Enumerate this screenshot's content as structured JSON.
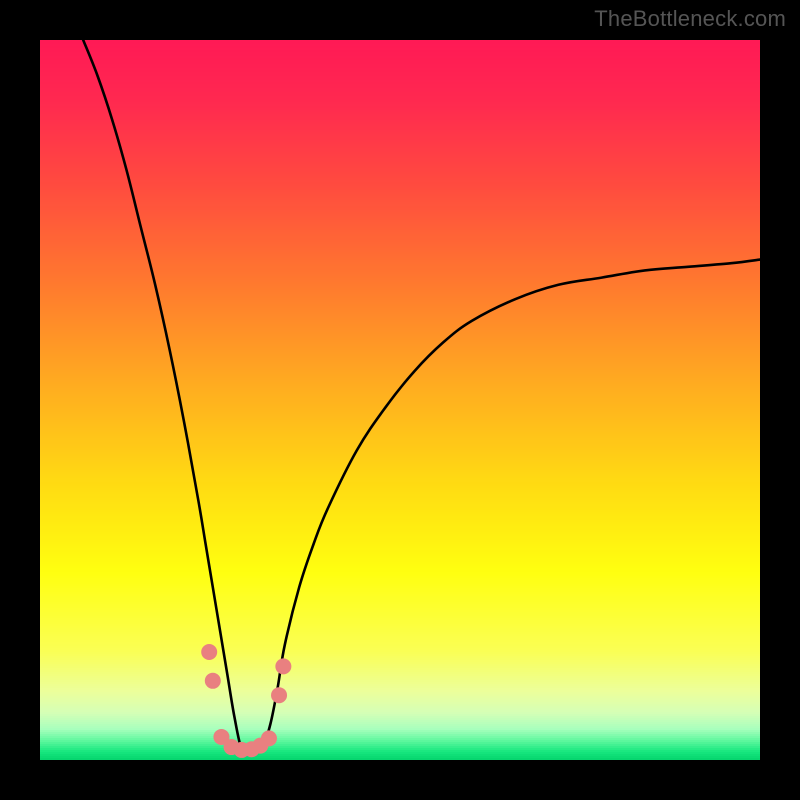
{
  "watermark": "TheBottleneck.com",
  "colors": {
    "frame": "#000000",
    "curve_stroke": "#000000",
    "marker_fill": "#e98080",
    "gradient_stops": [
      {
        "pos": 0.0,
        "color": "#ff1a55"
      },
      {
        "pos": 0.08,
        "color": "#ff2850"
      },
      {
        "pos": 0.2,
        "color": "#ff4b3f"
      },
      {
        "pos": 0.34,
        "color": "#ff7a2e"
      },
      {
        "pos": 0.5,
        "color": "#ffb31e"
      },
      {
        "pos": 0.62,
        "color": "#ffdc12"
      },
      {
        "pos": 0.74,
        "color": "#ffff10"
      },
      {
        "pos": 0.85,
        "color": "#faff55"
      },
      {
        "pos": 0.905,
        "color": "#ecff9a"
      },
      {
        "pos": 0.935,
        "color": "#d6ffb6"
      },
      {
        "pos": 0.958,
        "color": "#a9ffbd"
      },
      {
        "pos": 0.975,
        "color": "#5cf79d"
      },
      {
        "pos": 0.99,
        "color": "#16e77e"
      },
      {
        "pos": 1.0,
        "color": "#07d66f"
      }
    ]
  },
  "chart_data": {
    "type": "line",
    "title": "",
    "xlabel": "",
    "ylabel": "",
    "xlim": [
      0,
      100
    ],
    "ylim": [
      0,
      100
    ],
    "notes": "Single asymmetric V-shaped curve over a vertical color gradient (red at top through orange/yellow to green at bottom). Curve dips to ~0 near x≈28 and rises steeply on both sides; right branch is shallower than left. Small salmon markers cluster around the trough.",
    "series": [
      {
        "name": "curve",
        "x": [
          6,
          8,
          10,
          12,
          14,
          16,
          18,
          20,
          22,
          23,
          24,
          25,
          26,
          27,
          28,
          29,
          30,
          31,
          32,
          33,
          34,
          36,
          38,
          40,
          44,
          48,
          52,
          56,
          60,
          66,
          72,
          78,
          84,
          90,
          96,
          100
        ],
        "y": [
          100,
          95,
          89,
          82,
          74,
          66,
          57,
          47,
          36,
          30,
          24,
          18,
          12,
          6,
          1.5,
          1.2,
          1.2,
          2.0,
          5,
          10,
          16,
          24,
          30,
          35,
          43,
          49,
          54,
          58,
          61,
          64,
          66,
          67,
          68,
          68.5,
          69,
          69.5
        ]
      }
    ],
    "markers": {
      "name": "trough-markers",
      "points": [
        {
          "x": 23.5,
          "y": 15
        },
        {
          "x": 24.0,
          "y": 11
        },
        {
          "x": 25.2,
          "y": 3.2
        },
        {
          "x": 26.6,
          "y": 1.8
        },
        {
          "x": 28.0,
          "y": 1.4
        },
        {
          "x": 29.4,
          "y": 1.5
        },
        {
          "x": 30.6,
          "y": 2.0
        },
        {
          "x": 31.8,
          "y": 3.0
        },
        {
          "x": 33.2,
          "y": 9
        },
        {
          "x": 33.8,
          "y": 13
        }
      ],
      "radius": 8
    }
  }
}
